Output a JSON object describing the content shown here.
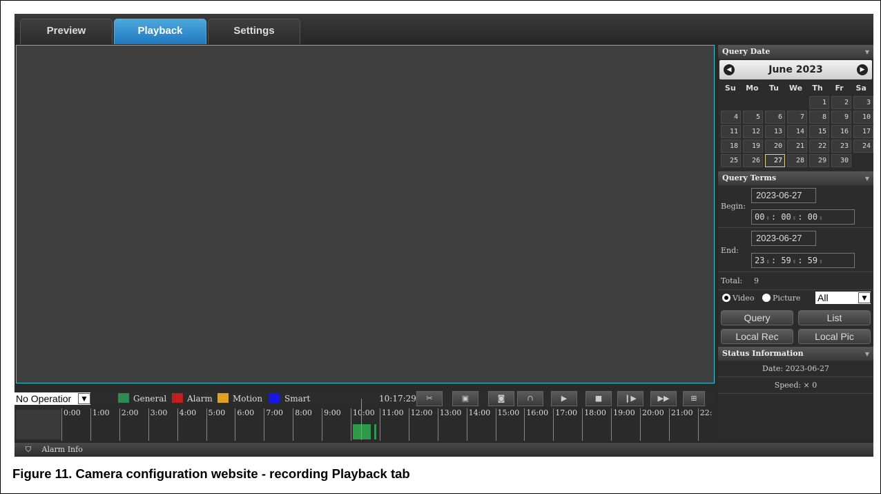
{
  "tabs": [
    {
      "label": "Preview"
    },
    {
      "label": "Playback"
    },
    {
      "label": "Settings"
    }
  ],
  "controls": {
    "operation_select": "No Operatior",
    "legend": [
      {
        "label": "General",
        "color": "#2e8a53"
      },
      {
        "label": "Alarm",
        "color": "#c01f1f"
      },
      {
        "label": "Motion",
        "color": "#e0a020"
      },
      {
        "label": "Smart",
        "color": "#1818e6"
      }
    ],
    "current_time": "10:17:29",
    "buttons": [
      {
        "name": "clip-icon",
        "glyph": "✂"
      },
      {
        "name": "record-icon",
        "glyph": "▣"
      },
      {
        "name": "camera-icon",
        "glyph": "◙"
      },
      {
        "name": "audio-icon",
        "glyph": "∩"
      },
      {
        "name": "play-icon",
        "glyph": "▶"
      },
      {
        "name": "stop-icon",
        "glyph": "■"
      },
      {
        "name": "step-forward-icon",
        "glyph": "❙▶"
      },
      {
        "name": "fast-forward-icon",
        "glyph": "▶▶"
      },
      {
        "name": "fullscreen-icon",
        "glyph": "⊞"
      }
    ]
  },
  "timeline": {
    "hours": [
      "0:00",
      "1:00",
      "2:00",
      "3:00",
      "4:00",
      "5:00",
      "6:00",
      "7:00",
      "8:00",
      "9:00",
      "10:00",
      "11:00",
      "12:00",
      "13:00",
      "14:00",
      "15:00",
      "16:00",
      "17:00",
      "18:00",
      "19:00",
      "20:00",
      "21:00",
      "22:"
    ]
  },
  "alarm_info": "Alarm Info",
  "query_date": {
    "header": "Query Date",
    "month_label": "June 2023",
    "weekdays": [
      "Su",
      "Mo",
      "Tu",
      "We",
      "Th",
      "Fr",
      "Sa"
    ],
    "days": [
      "",
      "",
      "",
      "",
      "1",
      "2",
      "3",
      "4",
      "5",
      "6",
      "7",
      "8",
      "9",
      "10",
      "11",
      "12",
      "13",
      "14",
      "15",
      "16",
      "17",
      "18",
      "19",
      "20",
      "21",
      "22",
      "23",
      "24",
      "25",
      "26",
      "27",
      "28",
      "29",
      "30",
      ""
    ],
    "selected": "27"
  },
  "query_terms": {
    "header": "Query Terms",
    "begin_label": "Begin:",
    "begin_date": "2023-06-27",
    "begin_time": [
      "00",
      "00",
      "00"
    ],
    "end_label": "End:",
    "end_date": "2023-06-27",
    "end_time": [
      "23",
      "59",
      "59"
    ],
    "total_label": "Total:",
    "total_value": "9",
    "video_label": "Video",
    "picture_label": "Picture",
    "type_select": "All",
    "query_button": "Query",
    "list_button": "List",
    "local_rec_button": "Local Rec",
    "local_pic_button": "Local Pic"
  },
  "status": {
    "header": "Status Information",
    "date": "Date: 2023-06-27",
    "speed": "Speed: × 0"
  },
  "caption": "Figure 11.  Camera configuration website - recording Playback tab"
}
